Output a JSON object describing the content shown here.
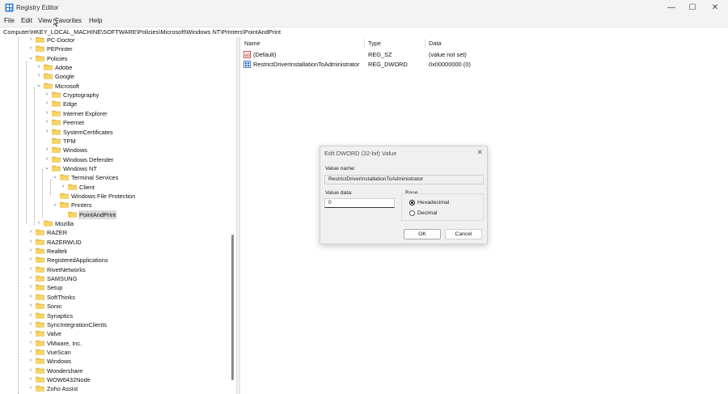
{
  "window": {
    "title": "Registry Editor",
    "minimize": "—",
    "maximize": "☐",
    "close": "✕"
  },
  "menu": [
    "File",
    "Edit",
    "View",
    "Favorites",
    "Help"
  ],
  "address": "Computer\\HKEY_LOCAL_MACHINE\\SOFTWARE\\Policies\\Microsoft\\Windows NT\\Printers\\PointAndPrint",
  "tree": [
    {
      "label": "PC-Doctor",
      "chev": "›"
    },
    {
      "label": "PEPrinter",
      "chev": "›"
    },
    {
      "label": "Policies",
      "chev": "⌄"
    },
    {
      "label": "Adobe",
      "chev": "›"
    },
    {
      "label": "Google",
      "chev": "›"
    },
    {
      "label": "Microsoft",
      "chev": "⌄"
    },
    {
      "label": "Cryptography",
      "chev": "›"
    },
    {
      "label": "Edge",
      "chev": "›"
    },
    {
      "label": "Internet Explorer",
      "chev": "›"
    },
    {
      "label": "Peernet",
      "chev": "›"
    },
    {
      "label": "SystemCertificates",
      "chev": "›"
    },
    {
      "label": "TPM",
      "chev": ""
    },
    {
      "label": "Windows",
      "chev": "›"
    },
    {
      "label": "Windows Defender",
      "chev": "›"
    },
    {
      "label": "Windows NT",
      "chev": "⌄"
    },
    {
      "label": "Terminal Services",
      "chev": "⌄"
    },
    {
      "label": "Client",
      "chev": "›"
    },
    {
      "label": "Windows File Protection",
      "chev": ""
    },
    {
      "label": "Printers",
      "chev": "⌄"
    },
    {
      "label": "PointAndPrint",
      "chev": "",
      "selected": true
    },
    {
      "label": "Mozilla",
      "chev": "›"
    },
    {
      "label": "RAZER",
      "chev": "›"
    },
    {
      "label": "RAZERWUD",
      "chev": "›"
    },
    {
      "label": "Realtek",
      "chev": "›"
    },
    {
      "label": "RegisteredApplications",
      "chev": "›"
    },
    {
      "label": "RivetNetworks",
      "chev": "›"
    },
    {
      "label": "SAMSUNG",
      "chev": "›"
    },
    {
      "label": "Setup",
      "chev": "›"
    },
    {
      "label": "SoftThinks",
      "chev": "›"
    },
    {
      "label": "Sonic",
      "chev": "›"
    },
    {
      "label": "Synaptics",
      "chev": "›"
    },
    {
      "label": "SyncIntegrationClients",
      "chev": "›"
    },
    {
      "label": "Valve",
      "chev": "›"
    },
    {
      "label": "VMware, Inc.",
      "chev": "›"
    },
    {
      "label": "VueScan",
      "chev": "›"
    },
    {
      "label": "Windows",
      "chev": "›"
    },
    {
      "label": "Wondershare",
      "chev": "›"
    },
    {
      "label": "WOW6432Node",
      "chev": "›"
    },
    {
      "label": "Zoho Assist",
      "chev": "›"
    }
  ],
  "columns": {
    "name": "Name",
    "type": "Type",
    "data": "Data"
  },
  "values": [
    {
      "name": "(Default)",
      "type": "REG_SZ",
      "data": "(value not set)",
      "icon": "string-value-icon"
    },
    {
      "name": "RestrictDriverInstallationToAdministrator",
      "type": "REG_DWORD",
      "data": "0x00000000 (0)",
      "icon": "dword-value-icon"
    }
  ],
  "dialog": {
    "title": "Edit DWORD (32-bit) Value",
    "close": "✕",
    "value_name_label": "Value name:",
    "value_name": "RestrictDriverInstallationToAdministrator",
    "value_data_label": "Value data:",
    "value_data": "0",
    "base_label": "Base",
    "hex_label": "Hexadecimal",
    "dec_label": "Decimal",
    "base_selected": "hexadecimal",
    "ok": "OK",
    "cancel": "Cancel"
  },
  "colors": {
    "folder": "#f2c94c",
    "selection": "#dcdcdc",
    "accent": "#1a1a1a"
  }
}
